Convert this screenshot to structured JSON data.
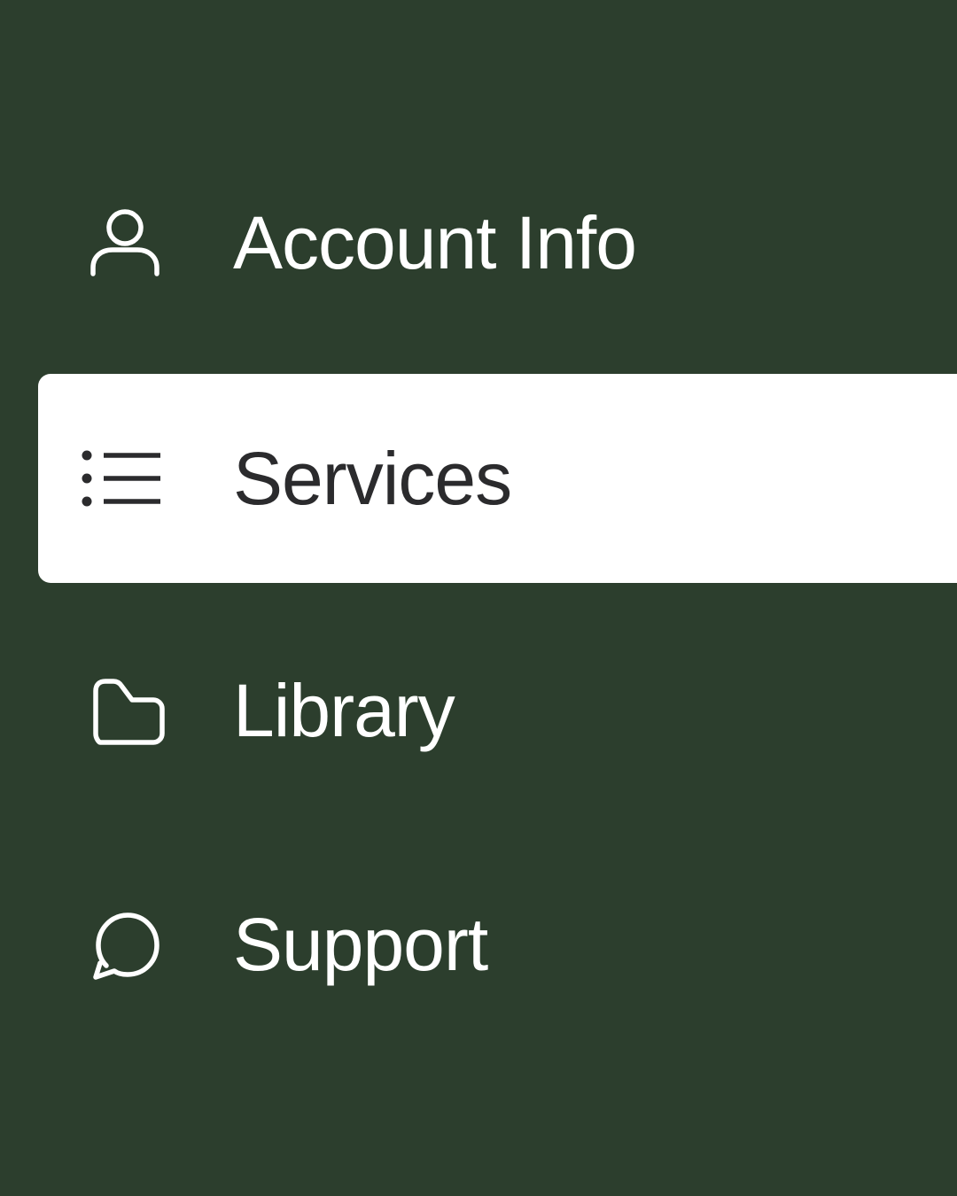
{
  "colors": {
    "background": "#2c3e2d",
    "active_background": "#ffffff",
    "inactive_text": "#ffffff",
    "active_text": "#2b2b2d"
  },
  "nav": {
    "active_item": "services",
    "items": [
      {
        "id": "account",
        "label": "Account Info",
        "icon": "user-icon",
        "active": false
      },
      {
        "id": "services",
        "label": "Services",
        "icon": "list-icon",
        "active": true
      },
      {
        "id": "library",
        "label": "Library",
        "icon": "folder-icon",
        "active": false
      },
      {
        "id": "support",
        "label": "Support",
        "icon": "chat-bubble-icon",
        "active": false
      }
    ]
  }
}
